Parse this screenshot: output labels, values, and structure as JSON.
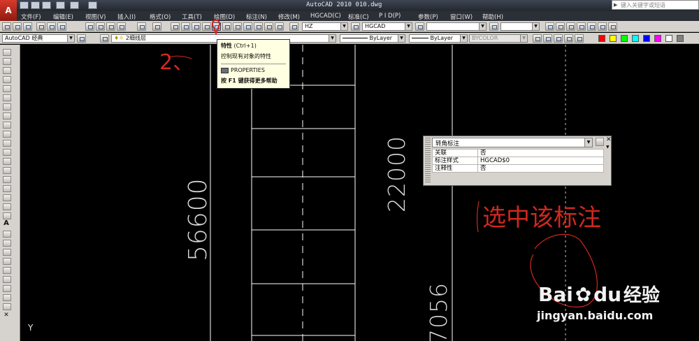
{
  "window": {
    "title": "AutoCAD 2010   010.dwg",
    "search_placeholder": "键入关键字或短语"
  },
  "menu": {
    "items": [
      "文件(F)",
      "编辑(E)",
      "视图(V)",
      "插入(I)",
      "格式(O)",
      "工具(T)",
      "绘图(D)",
      "标注(N)",
      "修改(M)",
      "HGCAD(C)",
      "标准(C)",
      "P I D(P)",
      "参数(P)",
      "窗口(W)",
      "帮助(H)"
    ]
  },
  "toolbar1": {
    "textstyle_value": "HZ",
    "dimstyle_value": "HGCAD"
  },
  "toolbar2": {
    "workspace_value": "AutoCAD 经典",
    "layer_value": "2细线层",
    "linetype_value": "ByLayer",
    "lineweight_value": "ByLayer",
    "plotstyle_value": "BYCOLOR"
  },
  "tooltip": {
    "title": "特性",
    "shortcut": "(Ctrl+1)",
    "description": "控制现有对象的特性",
    "command": "PROPERTIES",
    "help": "按 F1 键获得更多帮助"
  },
  "quick_properties": {
    "object_type": "转角标注",
    "rows": [
      {
        "key": "关联",
        "value": "否"
      },
      {
        "key": "标注样式",
        "value": "HGCAD$0"
      },
      {
        "key": "注释性",
        "value": "否"
      }
    ]
  },
  "canvas": {
    "dimensions": [
      "56600",
      "22000",
      "7056"
    ],
    "ucs_label": "Y",
    "annotations": {
      "step_number": "2、",
      "instruction": "选中该标注"
    }
  },
  "watermark": {
    "brand": "Bai",
    "brand2": "du",
    "brand_cn": "经验",
    "url": "jingyan.baidu.com"
  },
  "colors": {
    "canvas_bg": "#000000",
    "drawing_line": "#ffffff",
    "annotation_red": "#d0281f",
    "toolbar_bg": "#d6d3ce",
    "titlebar_bg": "#2b2f36",
    "tooltip_bg": "#ffffe1"
  },
  "icons": {
    "logo": "autocad-logo-icon",
    "properties": "properties-icon",
    "marker": "red-location-marker-icon"
  }
}
